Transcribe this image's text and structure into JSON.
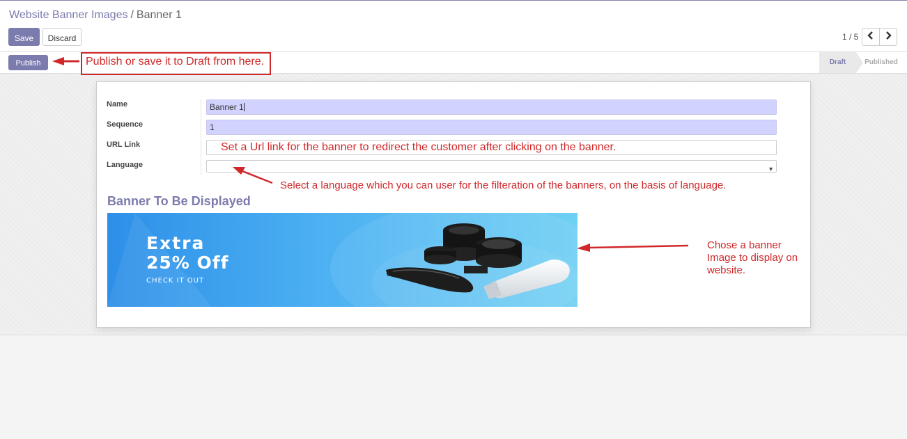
{
  "breadcrumb": {
    "parent": "Website Banner Images",
    "separator": "/",
    "current": "Banner 1"
  },
  "toolbar": {
    "save_label": "Save",
    "discard_label": "Discard"
  },
  "pager": {
    "value": "1 / 5",
    "prev_icon": "chevron-left-icon",
    "next_icon": "chevron-right-icon"
  },
  "statusbar": {
    "publish_label": "Publish",
    "stages": [
      "Draft",
      "Published"
    ],
    "active_stage": "Draft"
  },
  "form": {
    "fields": [
      {
        "label": "Name",
        "value": "Banner 1"
      },
      {
        "label": "Sequence",
        "value": "1"
      },
      {
        "label": "URL Link",
        "value": ""
      },
      {
        "label": "Language",
        "value": ""
      }
    ],
    "section_title": "Banner To Be Displayed"
  },
  "banner": {
    "line1": "Extra",
    "line2": "25% Off",
    "line3": "CHECK IT OUT"
  },
  "annotations": {
    "publish_note": "Publish or save it to Draft from here.",
    "url_note": "Set a Url link for the banner to redirect the customer after clicking on the banner.",
    "language_note": "Select a language which you can user for the filteration of the banners, on the basis of language.",
    "image_note_lines": [
      "Chose a banner",
      "Image to display on",
      "website."
    ]
  },
  "colors": {
    "brand": "#7c7bad",
    "annotation": "#d0282a",
    "required_field": "#d2d2ff"
  }
}
